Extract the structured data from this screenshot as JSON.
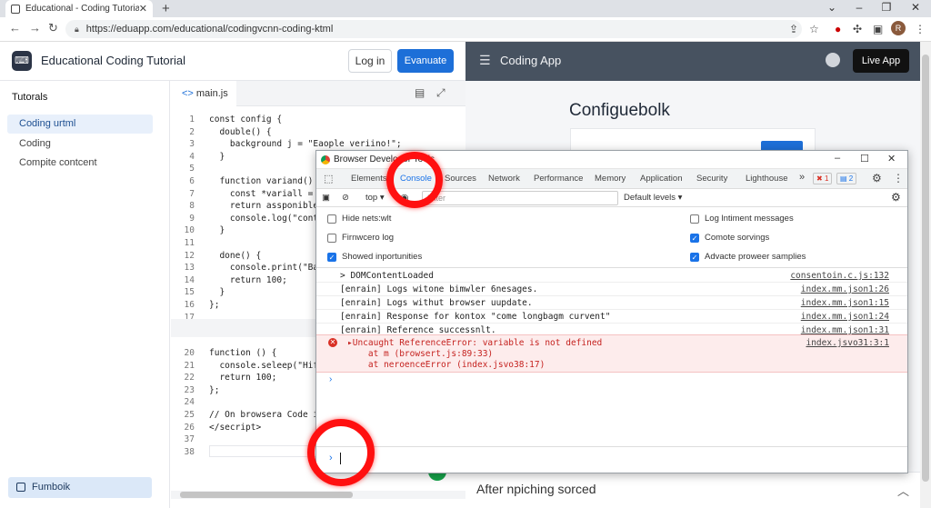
{
  "browser": {
    "tab_title": "Educational - Coding Tutorial | …",
    "url": "https://eduapp.com/educational/codingvcnn-coding-ktml",
    "profile_initial": "R"
  },
  "app": {
    "title": "Educational Coding Tutorial",
    "login_label": "Log in",
    "evaluate_label": "Evanuate"
  },
  "sidebar": {
    "heading": "Tutorals",
    "items": [
      {
        "label": "Coding urtml",
        "active": true
      },
      {
        "label": "Coding",
        "active": false
      },
      {
        "label": "Compite contcent",
        "active": false
      }
    ],
    "footer_label": "Fumboik"
  },
  "editor": {
    "file_tab": "main.js",
    "lines_top": [
      {
        "n": "1",
        "code": "const config {"
      },
      {
        "n": "2",
        "code": "  double() {"
      },
      {
        "n": "3",
        "code": "    background j = \"Eaople veriino!\";"
      },
      {
        "n": "4",
        "code": "  }"
      },
      {
        "n": "5",
        "code": ""
      },
      {
        "n": "6",
        "code": "  function variand() {"
      },
      {
        "n": "7",
        "code": "    const *variall = 1"
      },
      {
        "n": "8",
        "code": "    return assponible."
      },
      {
        "n": "9",
        "code": "    console.log(\"conte"
      },
      {
        "n": "10",
        "code": "  }"
      },
      {
        "n": "11",
        "code": ""
      },
      {
        "n": "12",
        "code": "  done() {"
      },
      {
        "n": "13",
        "code": "    console.print(\"Bar"
      },
      {
        "n": "14",
        "code": "    return 100;"
      },
      {
        "n": "15",
        "code": "  }"
      },
      {
        "n": "16",
        "code": "};"
      },
      {
        "n": "17",
        "code": ""
      }
    ],
    "lines_bottom": [
      {
        "n": "20",
        "code": "function () {"
      },
      {
        "n": "21",
        "code": "  console.seleep(\"Hifs"
      },
      {
        "n": "22",
        "code": "  return 100;"
      },
      {
        "n": "23",
        "code": "};"
      },
      {
        "n": "24",
        "code": ""
      },
      {
        "n": "25",
        "code": "// On browsera Code in"
      },
      {
        "n": "26",
        "code": "</secript>"
      },
      {
        "n": "37",
        "code": ""
      },
      {
        "n": "38",
        "code": ""
      }
    ]
  },
  "right_app": {
    "name": "Coding App",
    "live_label": "Live App",
    "heading": "Configuebolk",
    "footer": "After npiching sorced"
  },
  "devtools": {
    "window_title": "Browser Developer Tools",
    "tabs": [
      "Elements",
      "Console",
      "Sources",
      "Network",
      "Performance",
      "Memory",
      "Application",
      "Security",
      "Lighthouse"
    ],
    "active_tab": "Console",
    "more": "»",
    "error_count": "1",
    "message_count": "2",
    "context": "top",
    "filter_placeholder": "Filter",
    "levels": "Default levels",
    "settings_left": [
      {
        "label": "Hide nets:wlt",
        "checked": false
      },
      {
        "label": "Firnwcero log",
        "checked": false
      },
      {
        "label": "Showed inportunities",
        "checked": true
      }
    ],
    "settings_right": [
      {
        "label": "Log lntiment messages",
        "checked": false
      },
      {
        "label": "Comote sorvings",
        "checked": true
      },
      {
        "label": "Advacte proweer samplies",
        "checked": true
      }
    ],
    "logs": [
      {
        "msg": "> DOMContentLoaded",
        "src": "consentoin.c.js:132"
      },
      {
        "msg": "[enrain] Logs witone bimwler 6nesages.",
        "src": "index.mm.json1:26"
      },
      {
        "msg": "[enrain] Logs withut browser uupdate.",
        "src": "index.mm.json1:15"
      },
      {
        "msg": "[enrain] Response for kontox \"come longbagm curvent\"",
        "src": "index.mm.json1:24"
      },
      {
        "msg": "[enrain] Reference successnlt.",
        "src": "index.mm.json1:31"
      }
    ],
    "error": {
      "line1": "▸Uncaught ReferenceError: variable is not defined",
      "line2": "    at m (browsert.js:89:33)",
      "line3": "    at neroenceError (index.jsvo38:17)",
      "src": "index.jsvo31:3:1"
    },
    "prompt": "›"
  },
  "colors": {
    "accent": "#1d6fd8",
    "highlight": "#ff1010",
    "right_header": "#475260",
    "error_bg": "#fdecec"
  }
}
